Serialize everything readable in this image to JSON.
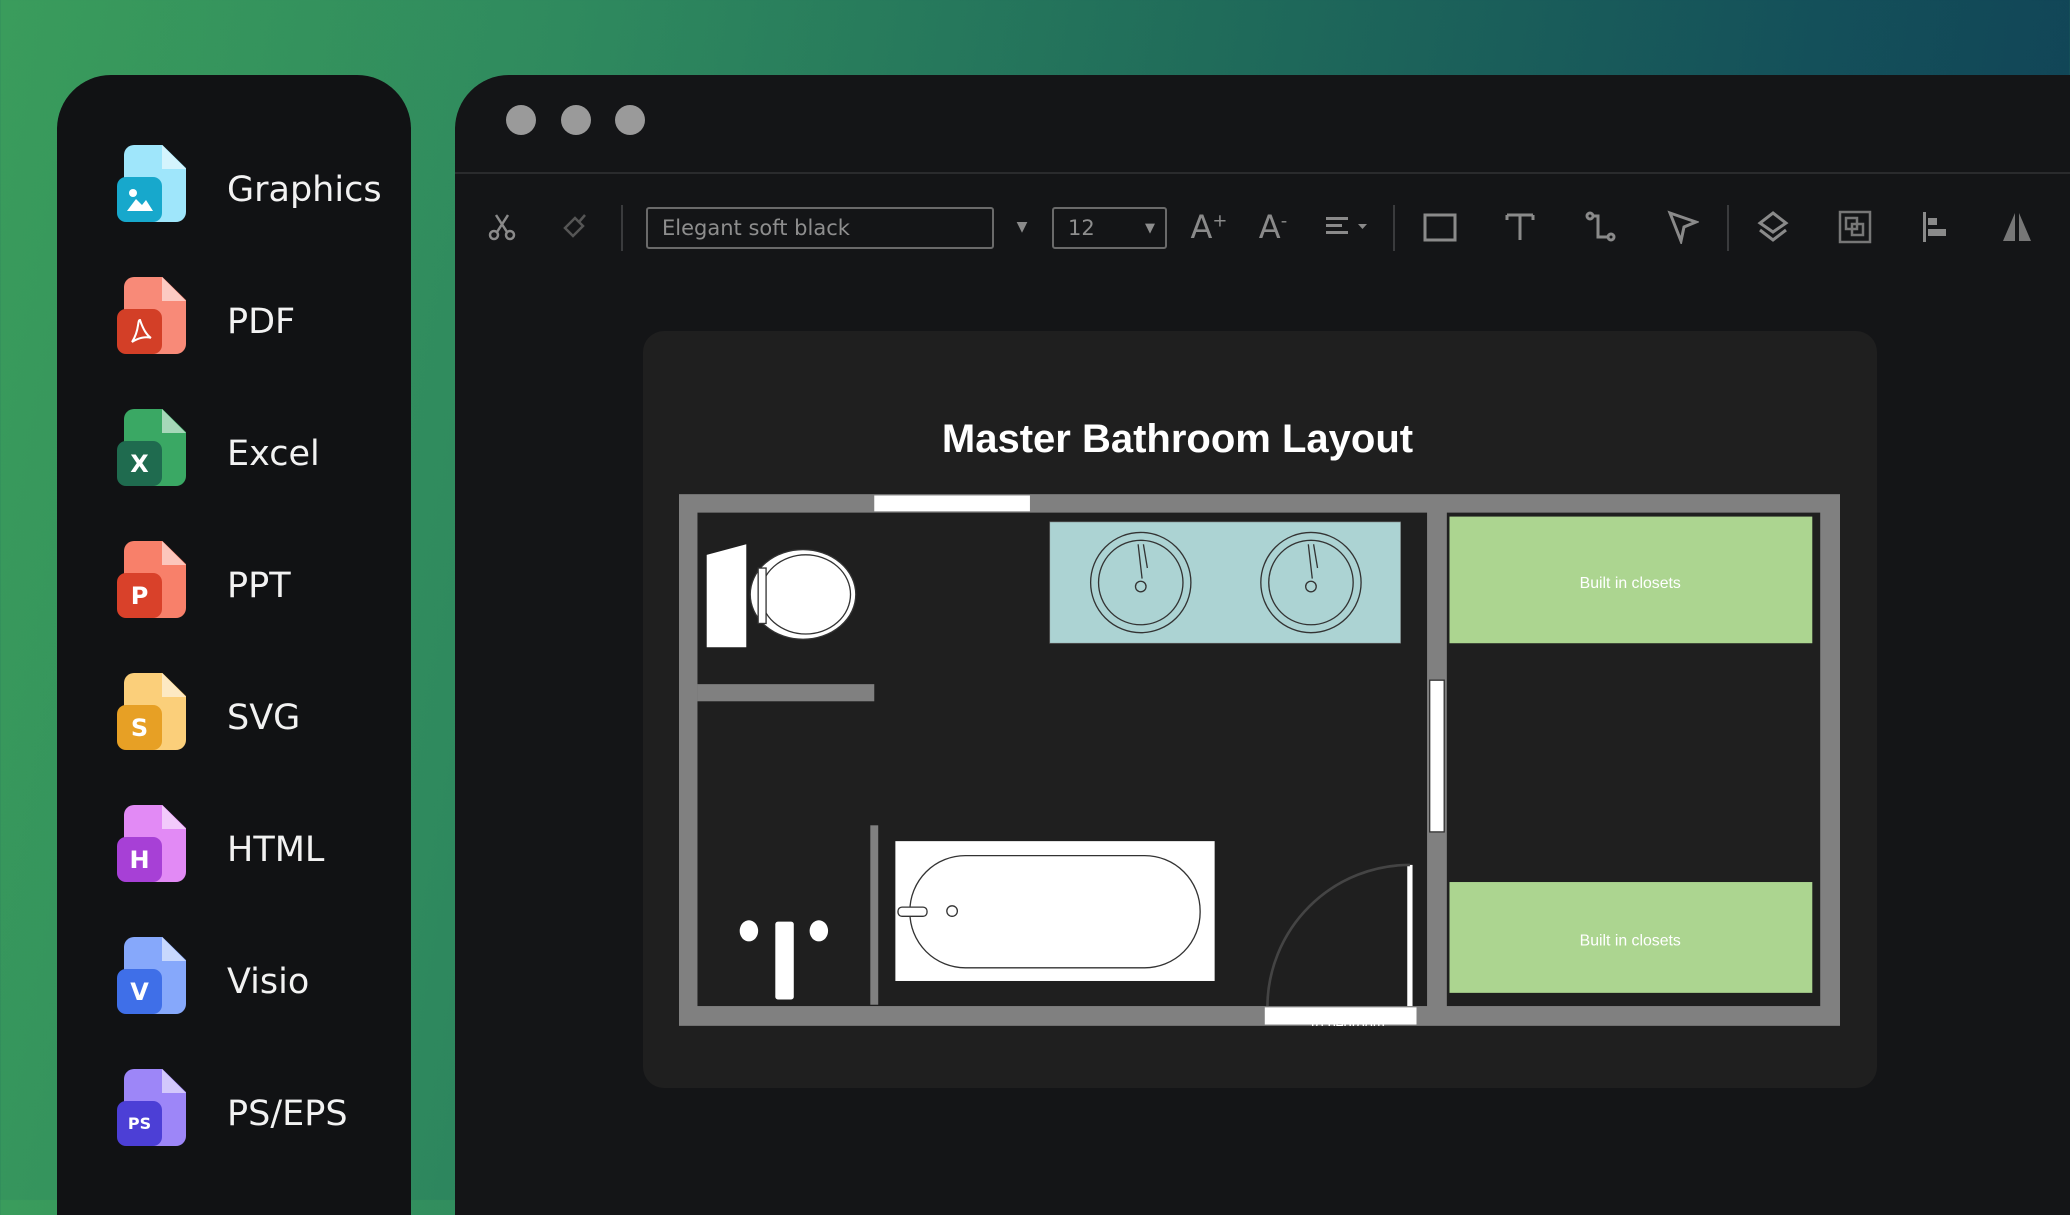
{
  "sidebar": {
    "items": [
      {
        "label": "Graphics",
        "icon": "image-file-icon",
        "color": "#9fe6fb",
        "badge_color": "#17a8cc",
        "badge": ""
      },
      {
        "label": "PDF",
        "icon": "pdf-file-icon",
        "color": "#f88a78",
        "badge_color": "#d33f27",
        "badge": ""
      },
      {
        "label": "Excel",
        "icon": "excel-file-icon",
        "color": "#3aa864",
        "badge_color": "#1f6b4f",
        "badge": "X"
      },
      {
        "label": "PPT",
        "icon": "ppt-file-icon",
        "color": "#f8806a",
        "badge_color": "#d9412a",
        "badge": "P"
      },
      {
        "label": "SVG",
        "icon": "svg-file-icon",
        "color": "#fbcf7a",
        "badge_color": "#e7a025",
        "badge": "S"
      },
      {
        "label": "HTML",
        "icon": "html-file-icon",
        "color": "#e28af5",
        "badge_color": "#a740d6",
        "badge": "H"
      },
      {
        "label": "Visio",
        "icon": "visio-file-icon",
        "color": "#86a8fb",
        "badge_color": "#3f6fe8",
        "badge": "V"
      },
      {
        "label": "PS/EPS",
        "icon": "ps-eps-file-icon",
        "color": "#9d86f8",
        "badge_color": "#4c3fd6",
        "badge": "PS"
      }
    ]
  },
  "toolbar": {
    "font_value": "Elegant soft black",
    "size_value": "12"
  },
  "canvas": {
    "title": "Master Bathroom Layout",
    "closet_label_1": "Built in closets",
    "closet_label_2": "Built in closets",
    "door_label": "To bedroom",
    "colors": {
      "wall": "#808080",
      "vanity": "#acd3d3",
      "closet": "#acd590"
    }
  }
}
